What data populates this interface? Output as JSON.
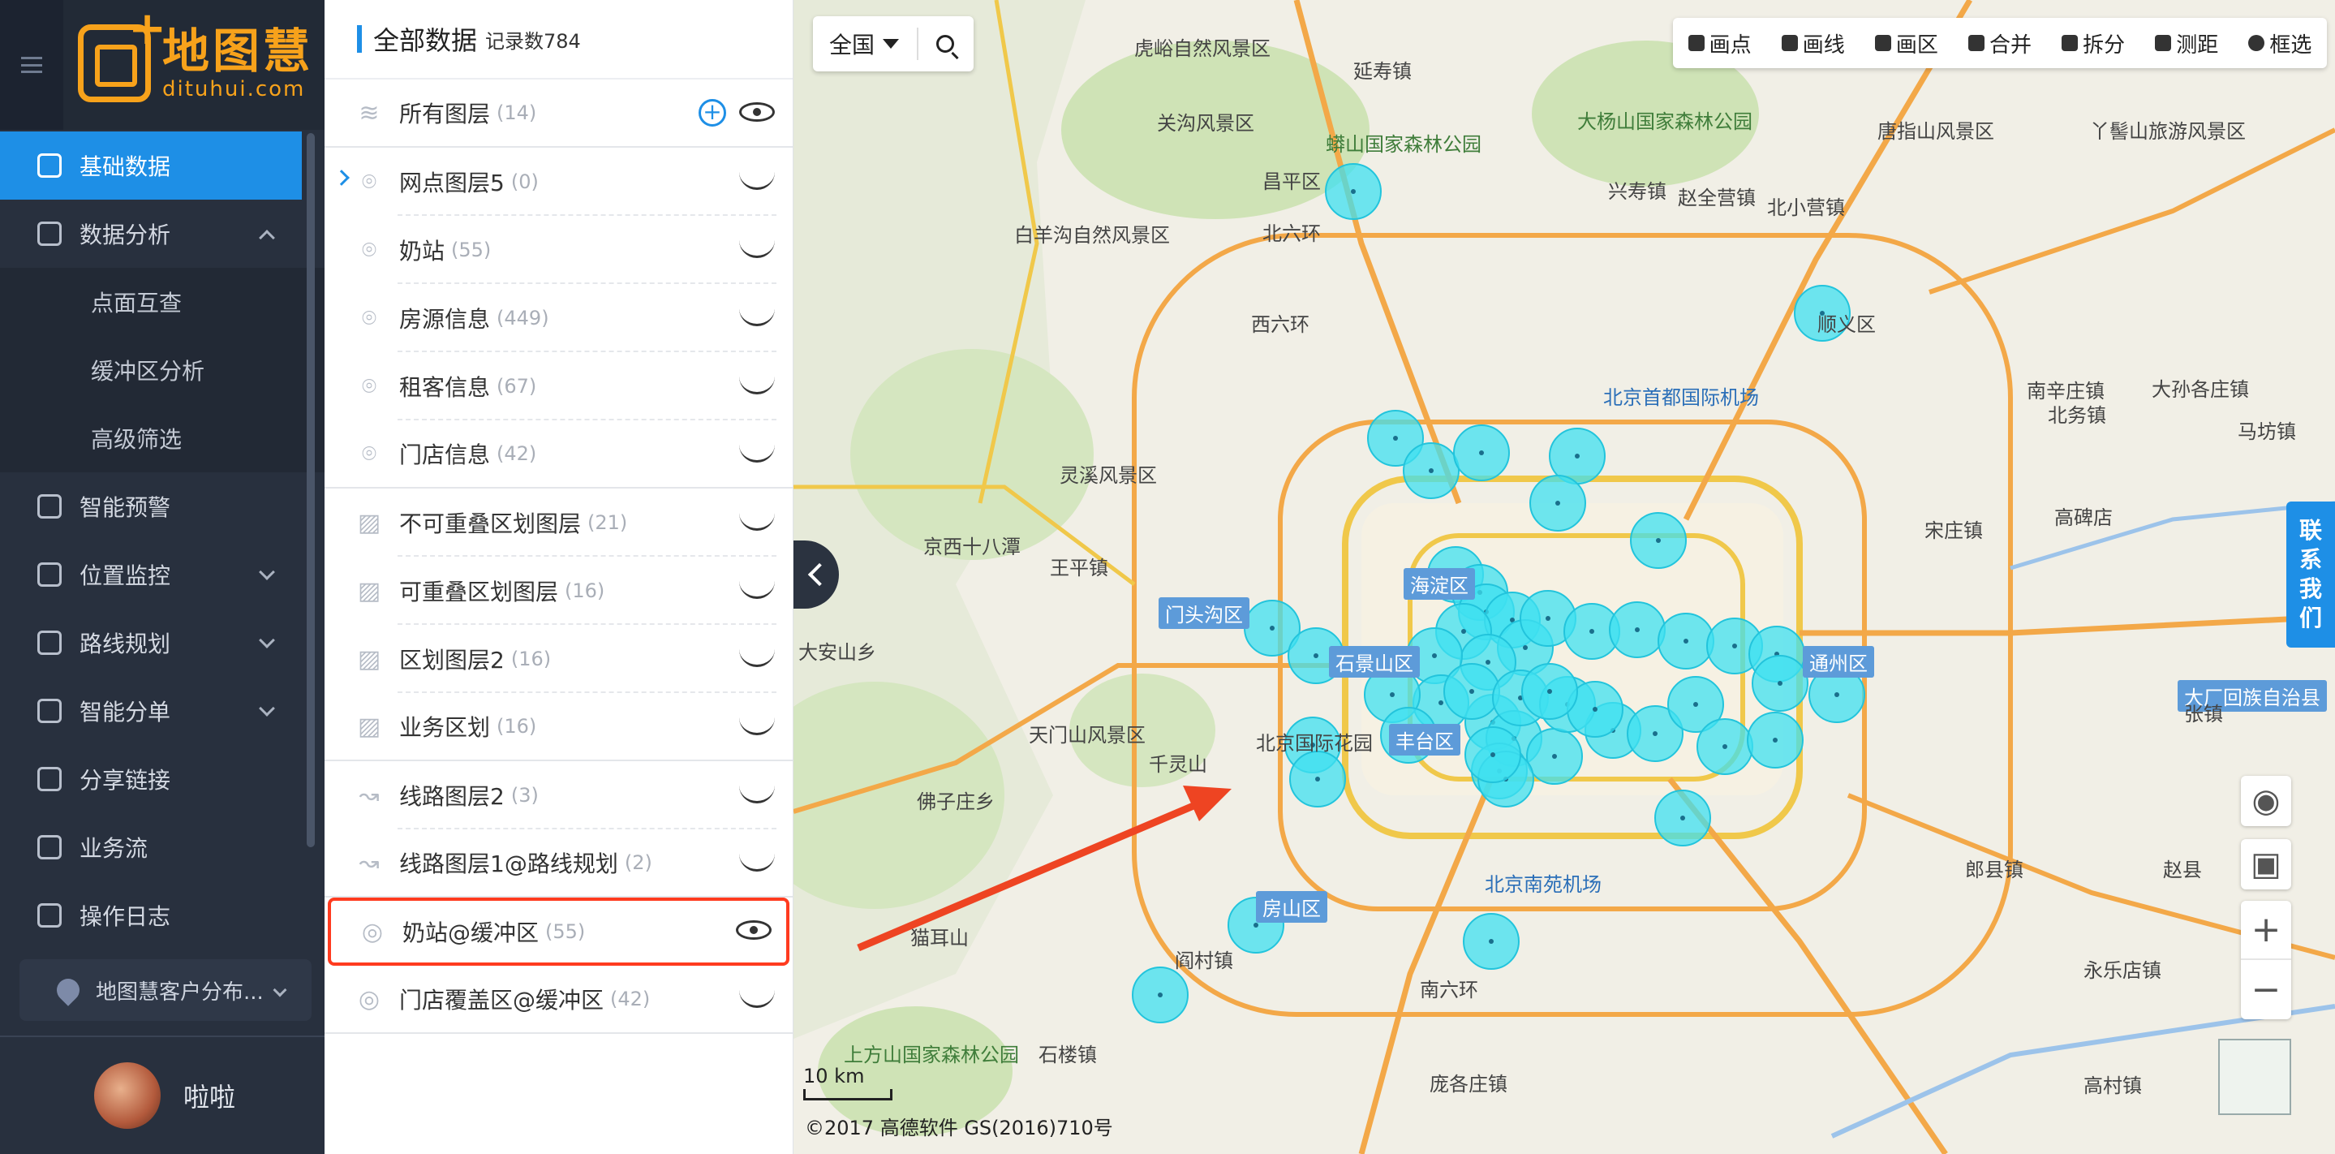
{
  "brand": {
    "name": "地图慧",
    "url": "dituhui.com"
  },
  "nav": {
    "items": [
      {
        "label": "基础数据",
        "active": true
      },
      {
        "label": "数据分析",
        "expanded": true
      },
      {
        "label": "点面互查",
        "sub": true
      },
      {
        "label": "缓冲区分析",
        "sub": true
      },
      {
        "label": "高级筛选",
        "sub": true
      },
      {
        "label": "智能预警"
      },
      {
        "label": "位置监控",
        "collapsible": true
      },
      {
        "label": "路线规划",
        "collapsible": true
      },
      {
        "label": "智能分单",
        "collapsible": true
      },
      {
        "label": "分享链接"
      },
      {
        "label": "业务流"
      },
      {
        "label": "操作日志"
      }
    ],
    "workspace": "地图慧客户分布...",
    "user": "啦啦"
  },
  "panel": {
    "title": "全部数据",
    "record_count": "记录数784",
    "all_layers": {
      "label": "所有图层",
      "count": "(14)"
    },
    "layers": [
      {
        "label": "网点图层5",
        "count": "(0)",
        "icon": "location-icon",
        "visible": false
      },
      {
        "label": "奶站",
        "count": "(55)",
        "icon": "location-icon",
        "visible": false
      },
      {
        "label": "房源信息",
        "count": "(449)",
        "icon": "location-icon",
        "visible": false
      },
      {
        "label": "租客信息",
        "count": "(67)",
        "icon": "location-icon",
        "visible": false
      },
      {
        "label": "门店信息",
        "count": "(42)",
        "icon": "location-icon",
        "visible": false
      },
      {
        "label": "不可重叠区划图层",
        "count": "(21)",
        "icon": "region-icon",
        "visible": false
      },
      {
        "label": "可重叠区划图层",
        "count": "(16)",
        "icon": "region-icon",
        "visible": false
      },
      {
        "label": "区划图层2",
        "count": "(16)",
        "icon": "region-icon",
        "visible": false
      },
      {
        "label": "业务区划",
        "count": "(16)",
        "icon": "region-icon",
        "visible": false
      },
      {
        "label": "线路图层2",
        "count": "(3)",
        "icon": "route-icon",
        "visible": false
      },
      {
        "label": "线路图层1@路线规划",
        "count": "(2)",
        "icon": "route-icon",
        "visible": false
      },
      {
        "label": "奶站@缓冲区",
        "count": "(55)",
        "icon": "buffer-icon",
        "visible": true
      },
      {
        "label": "门店覆盖区@缓冲区",
        "count": "(42)",
        "icon": "buffer-icon",
        "visible": false
      }
    ]
  },
  "map": {
    "region_select": "全国",
    "tools": [
      "画点",
      "画线",
      "画区",
      "合并",
      "拆分",
      "测距",
      "框选"
    ],
    "contact": [
      "联",
      "系",
      "我",
      "们"
    ],
    "scale": "10 km",
    "copyright": "©2017 高德软件 GS(2016)710号",
    "buffer_color": "#3fe0f0",
    "annotation_arrow_color": "#ee4422",
    "labels": [
      "虎峪自然风景区",
      "延寿镇",
      "关沟风景区",
      "蟒山国家森林公园",
      "大杨山国家森林公园",
      "白羊沟自然风景区",
      "昌平区",
      "北六环",
      "兴寿镇",
      "赵全营镇",
      "北小营镇",
      "唐指山风景区",
      "丫髻山旅游风景区",
      "西六环",
      "北京首都国际机场",
      "顺义区",
      "灵溪风景区",
      "京西十八潭",
      "王平镇",
      "门头沟区",
      "海淀区",
      "石景山区",
      "北京国际花园",
      "丰台区",
      "天门山风景区",
      "千灵山",
      "佛子庄乡",
      "大安山乡",
      "通州区",
      "大厂回族自治县",
      "北京南苑机场",
      "房山区",
      "阎村镇",
      "南六环",
      "上方山国家森林公园",
      "猫耳山",
      "石楼镇",
      "庞各庄镇",
      "高碑店",
      "宋庄镇",
      "张镇",
      "马坊镇",
      "北务镇",
      "大孙各庄镇",
      "永乐店镇",
      "郎县镇",
      "高村镇",
      "赵县",
      "南辛庄镇"
    ]
  }
}
